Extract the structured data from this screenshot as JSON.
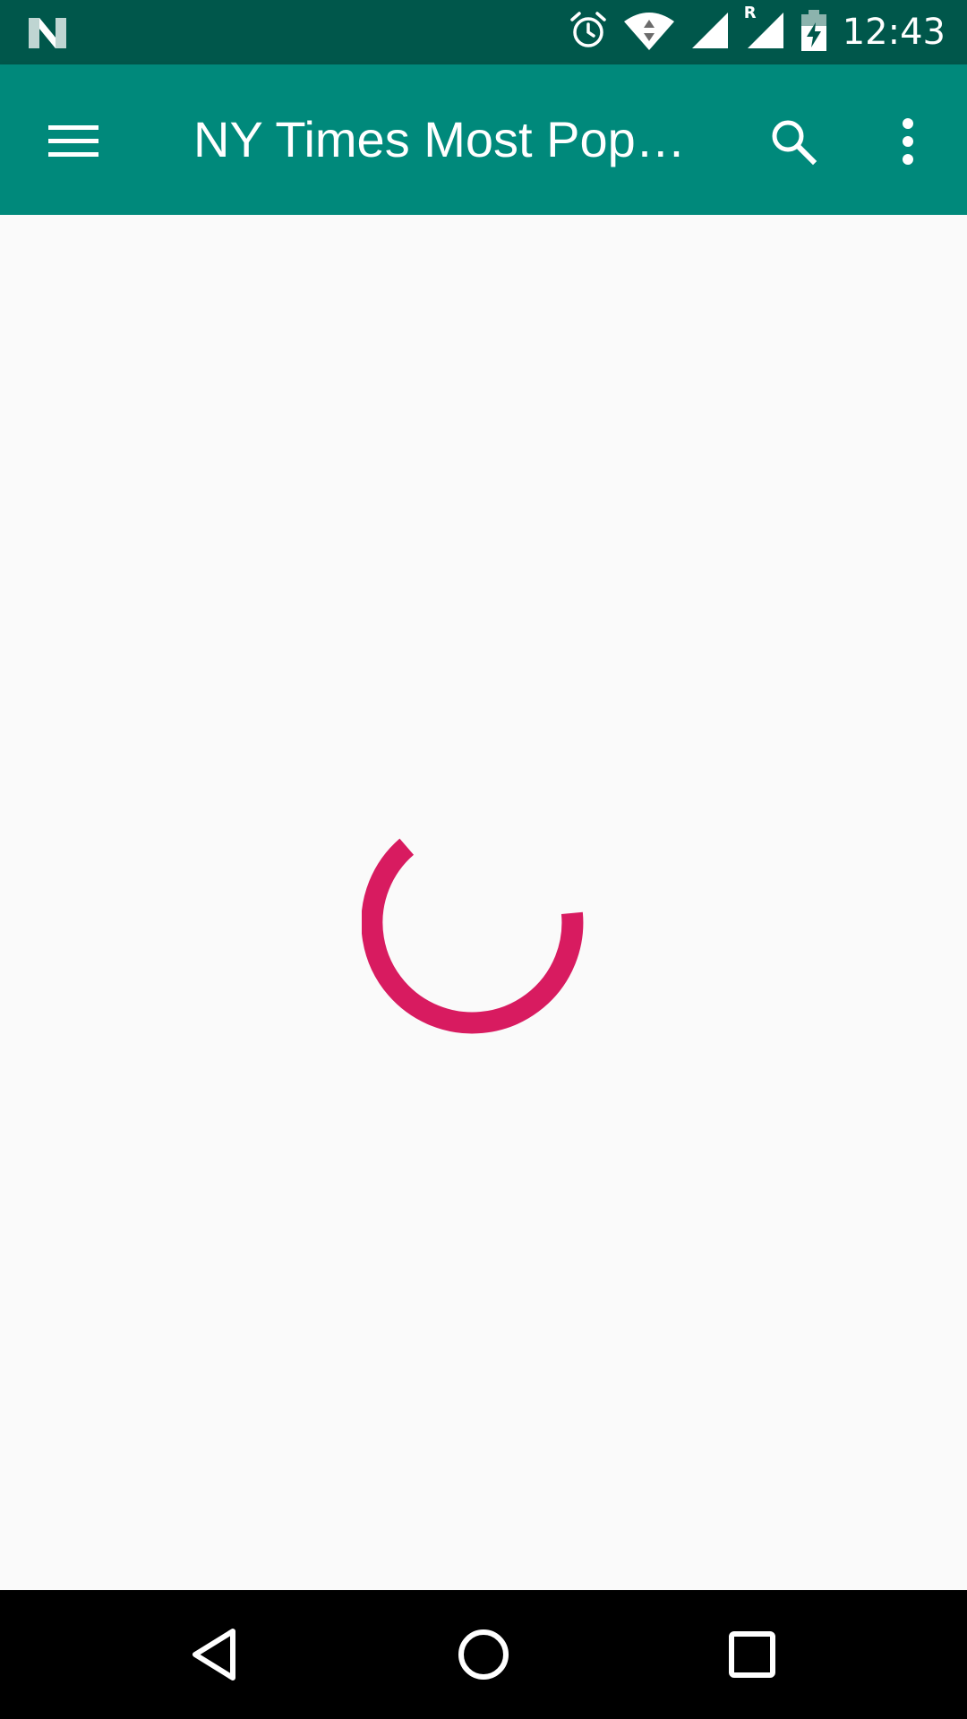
{
  "status_bar": {
    "time": "12:43",
    "icons": [
      "notification-n-icon",
      "alarm-icon",
      "wifi-icon",
      "cell-signal-icon",
      "roaming-signal-icon",
      "battery-charging-icon"
    ],
    "roaming_label": "R",
    "background_color": "#00574b"
  },
  "app_bar": {
    "title": "NY Times Most Pop…",
    "menu_icon": "menu-icon",
    "search_icon": "search-icon",
    "more_icon": "more-vert-icon",
    "background_color": "#00897b"
  },
  "content": {
    "loading": true,
    "spinner_color": "#d81b60",
    "background_color": "#fafafa"
  },
  "nav_bar": {
    "buttons": [
      "back-icon",
      "home-icon",
      "recents-icon"
    ],
    "background_color": "#000000"
  }
}
